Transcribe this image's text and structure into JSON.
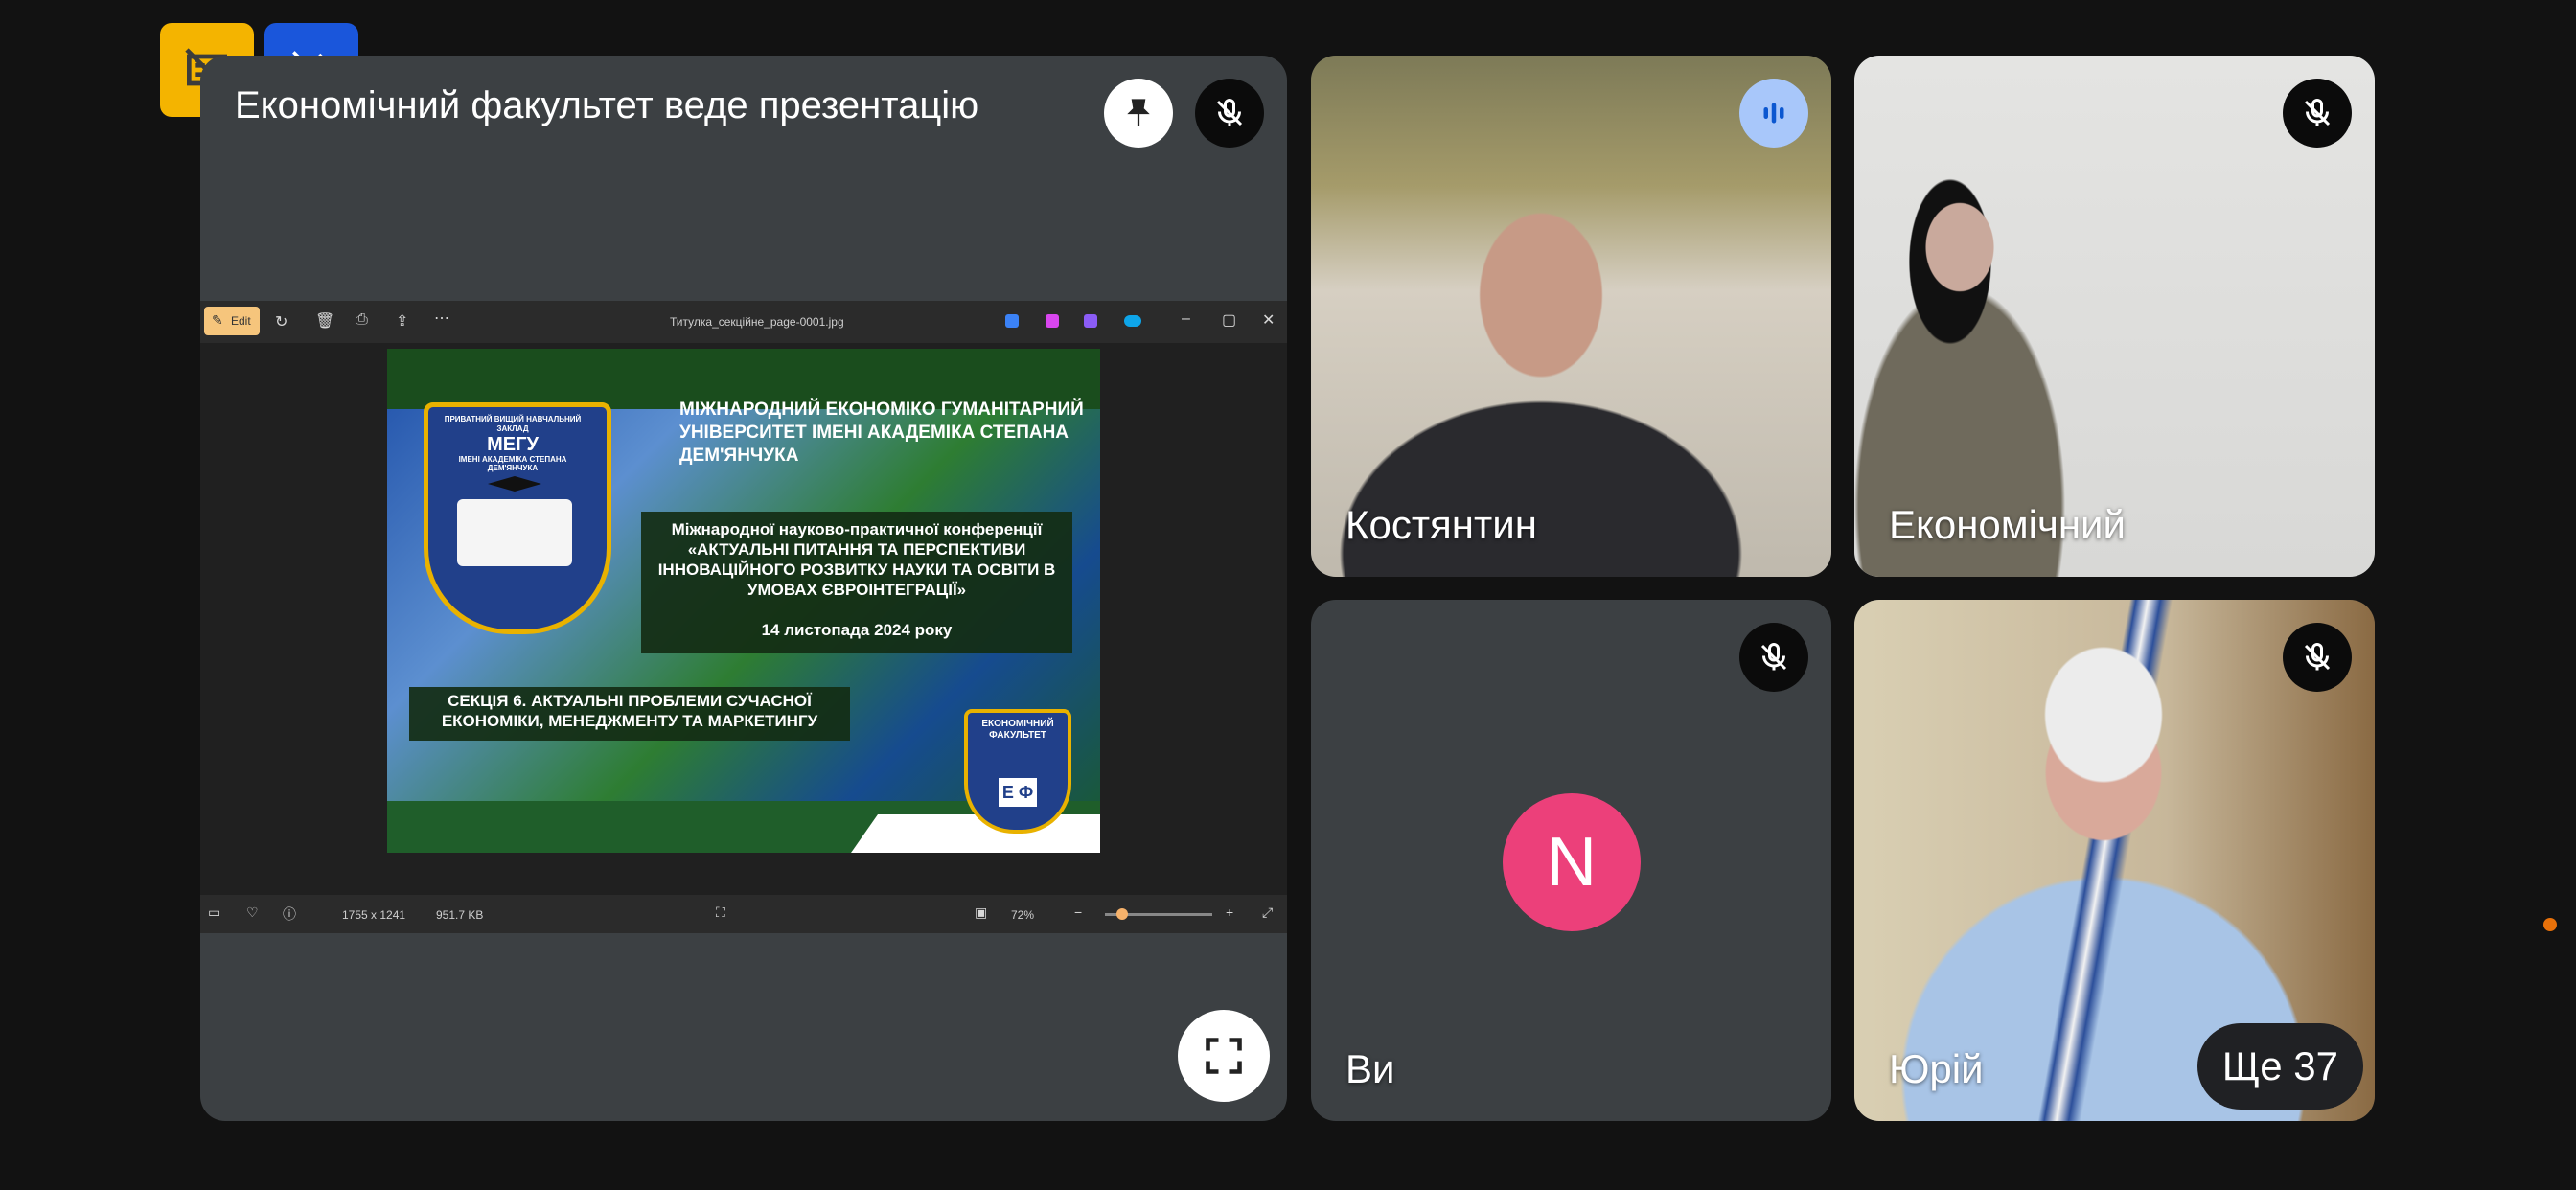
{
  "presentation": {
    "title": "Економічний факультет веде презентацію",
    "viewer": {
      "edit_label": "Edit",
      "file_name": "Титулка_секційне_page-0001.jpg",
      "dimensions": "1755 x 1241",
      "file_size": "951.7 KB",
      "zoom": "72%",
      "zoom_level_fraction": 0.12
    },
    "slide": {
      "university": "МІЖНАРОДНИЙ ЕКОНОМІКО ГУМАНІТАРНИЙ УНІВЕРСИТЕТ ІМЕНІ АКАДЕМІКА СТЕПАНА ДЕМ'ЯНЧУКА",
      "conference": "Міжнародної науково-практичної конференції «АКТУАЛЬНІ ПИТАННЯ ТА ПЕРСПЕКТИВИ ІННОВАЦІЙНОГО РОЗВИТКУ НАУКИ ТА ОСВІТИ В УМОВАХ ЄВРОІНТЕГРАЦІЇ»",
      "date": "14 листопада 2024 року",
      "section": "СЕКЦІЯ 6. АКТУАЛЬНІ ПРОБЛЕМИ СУЧАСНОЇ ЕКОНОМІКИ, МЕНЕДЖМЕНТУ ТА МАРКЕТИНГУ",
      "crest_top": "ПРИВАТНИЙ ВИЩИЙ НАВЧАЛЬНИЙ ЗАКЛАД",
      "crest_title": "МЕГУ",
      "crest_sub": "ІМЕНІ АКАДЕМІКА СТЕПАНА ДЕМ'ЯНЧУКА",
      "badge_text": "ЕКОНОМІЧНИЙ ФАКУЛЬТЕТ",
      "badge_letters": "Е Ф"
    }
  },
  "participants": [
    {
      "name": "Костянтин",
      "status": "speaking"
    },
    {
      "name": "Економічний",
      "status": "muted"
    },
    {
      "name": "Ви",
      "status": "muted",
      "avatar_letter": "N",
      "avatar_color": "#ec407a"
    },
    {
      "name": "Юрій",
      "status": "muted"
    }
  ],
  "more_participants": "Ще 37",
  "colors": {
    "background": "#121212",
    "tile": "#3c4043",
    "speaking": "#a8c7fa",
    "caption_badge": "#f4b400",
    "annotate_badge": "#1a56db"
  },
  "icons": [
    "captions-off-icon",
    "annotate-icon",
    "pin-icon",
    "mic-off-icon",
    "speaking-icon",
    "fullscreen-icon"
  ]
}
